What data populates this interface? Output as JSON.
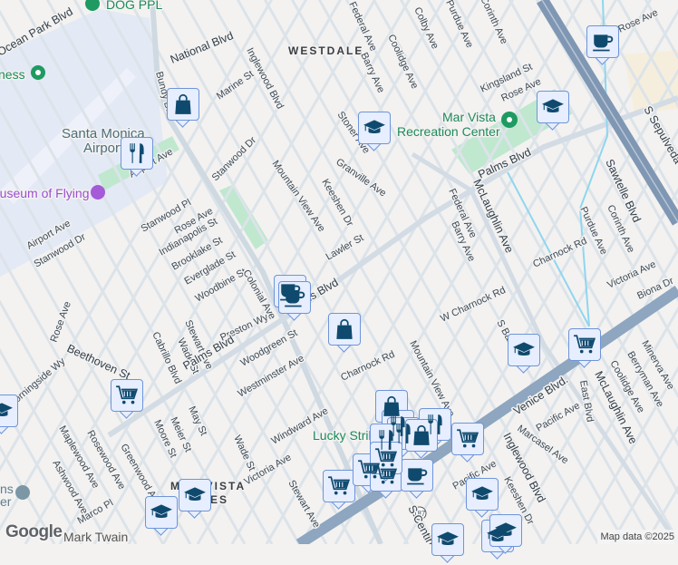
{
  "map": {
    "neighborhoods": [
      "WESTDALE",
      "MAR VISTA",
      "ES"
    ],
    "pois": {
      "dog_park": "DOG PPL",
      "fitness": "ness",
      "airport_line1": "Santa Monica",
      "airport_line2": "Airport",
      "museum": "Museum of Flying",
      "rec_center_line1": "Mar Vista",
      "rec_center_line2": "Recreation Center",
      "lucky_strike": "Lucky Strike",
      "mark_twain": "Mark Twain",
      "center_partial_1": "ns",
      "center_partial_2": "er"
    },
    "streets": {
      "ocean_park": "Ocean Park Blvd",
      "national": "National Blvd",
      "bundy": "Bundy Dr",
      "airport_ave_1": "Airport Ave",
      "airport_ave_2": "Airport Ave",
      "inglewood_n": "Inglewood Blvd",
      "marine": "Marine St",
      "stanwood_dr_1": "Stanwood Dr",
      "mountain_view_n": "Mountain View Ave",
      "keeshen_n": "Keeshen Dr",
      "lawler": "Lawler St",
      "stanwood_pl": "Stanwood Pl",
      "rose_1": "Rose Ave",
      "indianapolis": "Indianapolis St",
      "brooklake": "Brooklake St",
      "everglade": "Everglade St",
      "woodbine": "Woodbine St",
      "colonial": "Colonial Ave",
      "stanwood_dr_2": "Stanwood Dr",
      "rose_2": "Rose Ave",
      "beethoven": "Beethoven St",
      "morningside": "Morningside Wy",
      "cabrillo": "Cabrillo Blvd",
      "wade_1": "Wade St",
      "stewart_1": "Stewart Ave",
      "preston": "Preston Wy",
      "palms_1": "Palms Blvd",
      "palms_2": "Palms Blvd",
      "woodgreen": "Woodgreen St",
      "westminster": "Westminster Ave",
      "moore": "Moore St",
      "meier": "Meier St",
      "may": "May St",
      "maplewood": "Maplewood Ave",
      "rosewood": "Rosewood Ave",
      "greenwood": "Greenwood Ave",
      "ashwood": "Ashwood Ave",
      "marco": "Marco Pl",
      "wade_2": "Wade St",
      "windward": "Windward Ave",
      "victoria_1": "Victoria Ave",
      "stewart_2": "Stewart Ave",
      "stoner": "Stoner Ave",
      "granville": "Granville Ave",
      "federal_n": "Federal Ave",
      "barry_n": "Barry Ave",
      "coolidge_n": "Coolidge Ave",
      "colby": "Colby Ave",
      "purdue_n": "Purdue Ave",
      "corinth_n": "Corinth Ave",
      "kingsland": "Kingsland St",
      "rose_3": "Rose Ave",
      "rose_4": "Rose Ave",
      "palms_3": "Palms Blvd",
      "sepulveda": "S Sepulveda",
      "federal_s": "Federal Ave",
      "barry_s": "Barry Ave",
      "mclaughlin_n": "McLaughlin Ave",
      "sawtelle": "Sawtelle Blvd",
      "charnock_e": "Charnock Rd",
      "purdue_s": "Purdue Ave",
      "corinth_s": "Corinth Ave",
      "victoria_2": "Victoria Ave",
      "biona": "Biona Dr",
      "w_charnock": "W Charnock Rd",
      "charnock_w": "Charnock Rd",
      "mountain_view_s": "Mountain View Ave",
      "s_barry": "S Barry Ave",
      "venice": "Venice Blvd.",
      "mclaughlin_s": "McLaughlin Ave",
      "east_blvd": "East Blvd",
      "coolidge_s": "Coolidge Ave",
      "berryman": "Berryman Ave",
      "minerva": "Minerva Ave",
      "pacific_1": "Pacific Ave",
      "marcasel": "Marcasel Ave",
      "inglewood_s": "Inglewood Blvd",
      "pacific_2": "Pacific Ave",
      "keeshen_s": "Keeshen Dr",
      "centinela": "S Centinela",
      "route_shield": "187"
    },
    "markers": [
      {
        "type": "coffee"
      },
      {
        "type": "school"
      },
      {
        "type": "school"
      },
      {
        "type": "shopping"
      },
      {
        "type": "restaurant"
      },
      {
        "type": "coffee"
      },
      {
        "type": "coffee"
      },
      {
        "type": "shopping"
      },
      {
        "type": "grocery"
      },
      {
        "type": "school"
      },
      {
        "type": "school"
      },
      {
        "type": "grocery"
      },
      {
        "type": "shopping"
      },
      {
        "type": "restaurant"
      },
      {
        "type": "restaurant"
      },
      {
        "type": "restaurant"
      },
      {
        "type": "restaurant"
      },
      {
        "type": "shopping"
      },
      {
        "type": "grocery"
      },
      {
        "type": "grocery"
      },
      {
        "type": "grocery"
      },
      {
        "type": "grocery"
      },
      {
        "type": "coffee"
      },
      {
        "type": "grocery"
      },
      {
        "type": "school"
      },
      {
        "type": "school"
      },
      {
        "type": "school"
      },
      {
        "type": "school"
      },
      {
        "type": "school"
      },
      {
        "type": "school"
      }
    ],
    "colors": {
      "background": "#f3f2f1",
      "road": "#d6dee5",
      "highway": "#8ea6bf",
      "park": "#bfe8cf",
      "airport": "#e3e9f5",
      "marker_fill": "#e6eeff",
      "marker_border": "#6e95d8",
      "marker_icon": "#0f4a6e"
    }
  },
  "footer": {
    "logo": "Google",
    "attribution": "Map data ©2025"
  }
}
